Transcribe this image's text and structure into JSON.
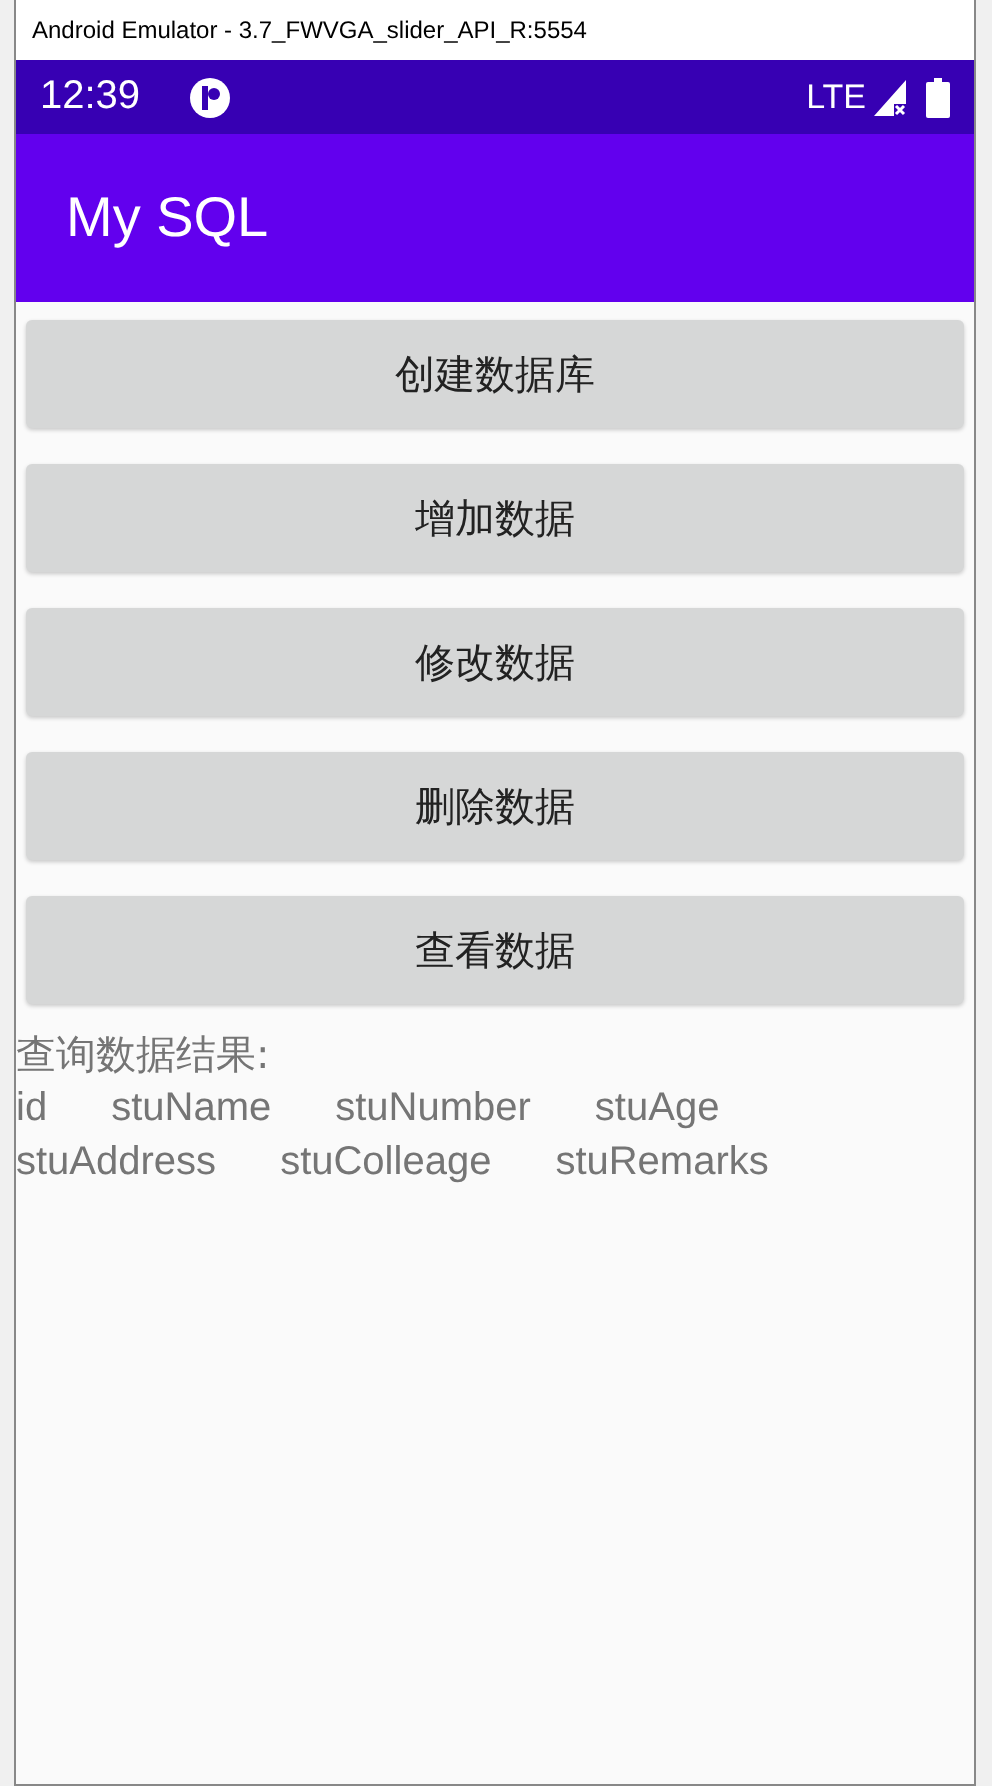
{
  "window": {
    "title": "Android Emulator - 3.7_FWVGA_slider_API_R:5554"
  },
  "status_bar": {
    "time": "12:39",
    "network": "LTE"
  },
  "app_bar": {
    "title": "My SQL"
  },
  "buttons": [
    "创建数据库",
    "增加数据",
    "修改数据",
    "删除数据",
    "查看数据"
  ],
  "result": {
    "label": "查询数据结果:",
    "lines": [
      [
        "id",
        "stuName",
        "stuNumber",
        "stuAge"
      ],
      [
        "stuAddress",
        "stuColleage",
        "stuRemarks"
      ]
    ]
  }
}
